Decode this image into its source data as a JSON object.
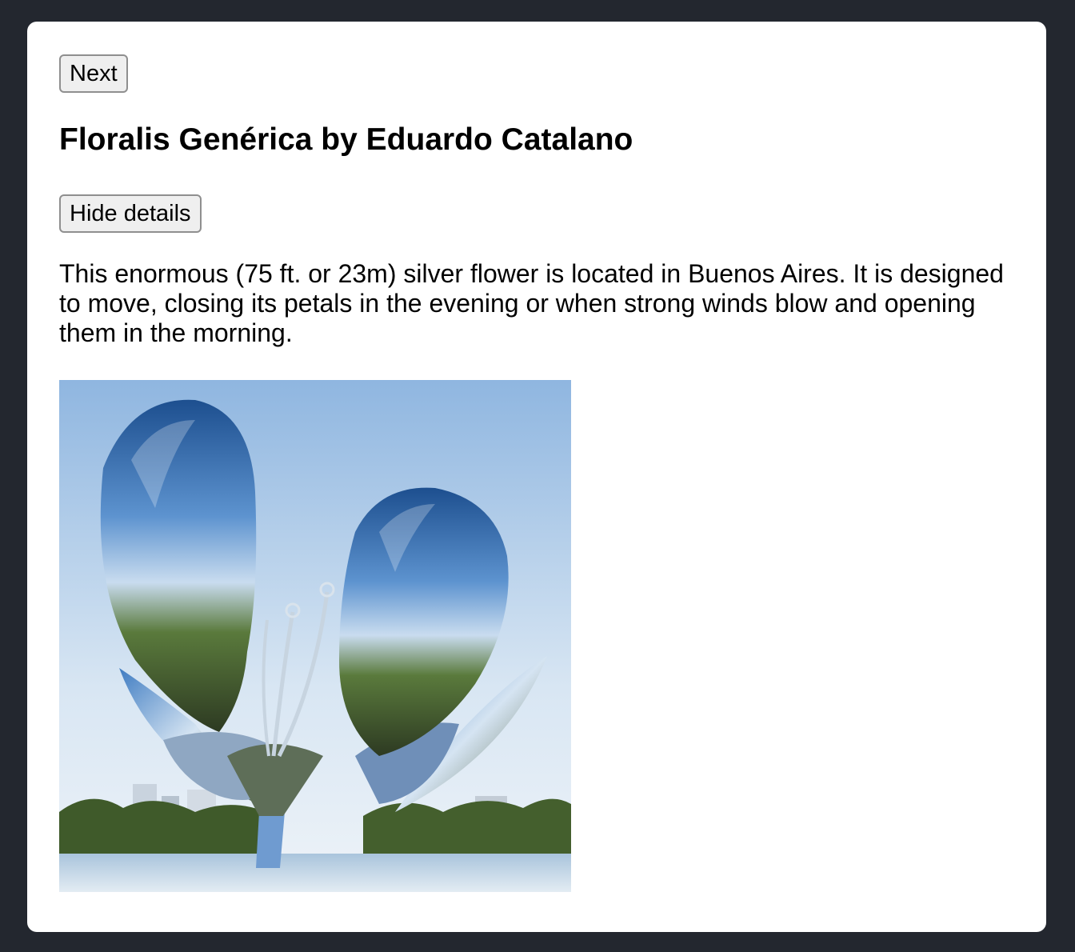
{
  "buttons": {
    "next_label": "Next",
    "hide_details_label": "Hide details"
  },
  "sculpture": {
    "title": "Floralis Genérica by Eduardo Catalano",
    "description": "This enormous (75 ft. or 23m) silver flower is located in Buenos Aires. It is designed to move, closing its petals in the evening or when strong winds blow and opening them in the morning."
  },
  "colors": {
    "page_background": "#23272f",
    "card_background": "#ffffff",
    "button_background": "#efefef"
  }
}
